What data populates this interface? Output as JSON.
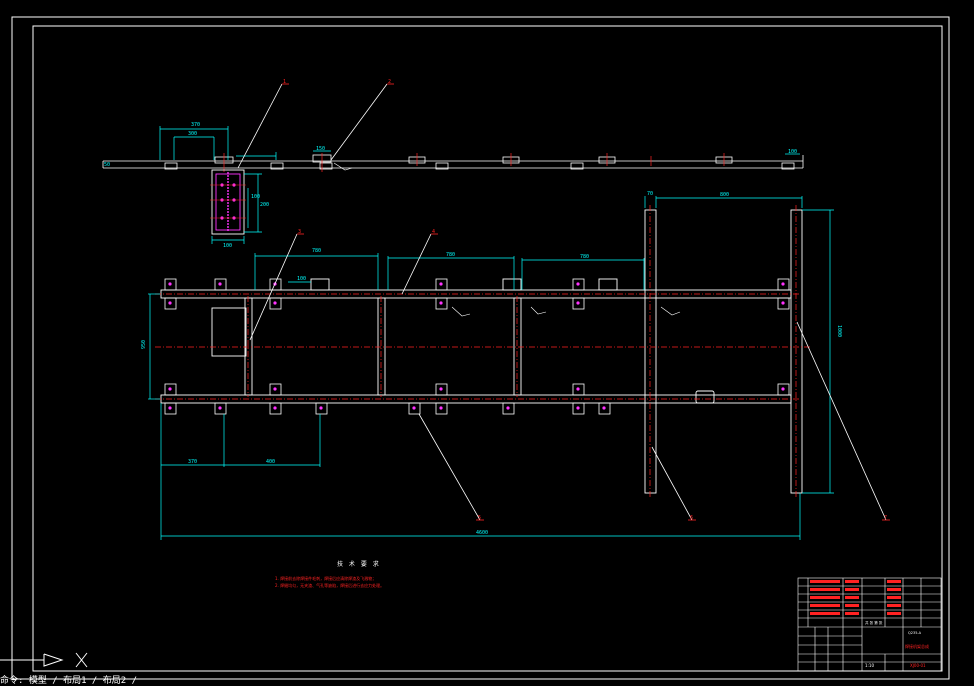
{
  "drawing": {
    "notes_title": "技 术 要 求",
    "notes": [
      "1. 焊接前去除焊接件毛刺，焊接后应清除焊渣及飞溅物；",
      "2. 焊缝均匀，无夹渣、气孔等缺陷，焊接后进行去应力处理。"
    ],
    "balloons": [
      "1",
      "2",
      "3",
      "4",
      "5",
      "6",
      "7",
      "8"
    ],
    "dims": {
      "top_width": "370",
      "top_inner": "300",
      "top_small": "150",
      "top_right": "100",
      "left_offset": "50",
      "col_h1": "100",
      "col_h2": "200",
      "col_w": "100",
      "span1": "780",
      "span2": "780",
      "span3": "780",
      "mid_small": "100",
      "frame_height": "950",
      "rail_width": "70",
      "rail_span": "800",
      "right_height": "1000",
      "bottom_left": "370",
      "bottom_mid": "400",
      "overall": "4600"
    },
    "title_block": {
      "drawing_name": "焊接机架总成",
      "drawing_no": "XJ00-01",
      "scale": "1:10",
      "sheet": "共 张 第 张",
      "material": "Q235-A"
    }
  },
  "colors": {
    "background": "#000000",
    "frame": "#ffffff",
    "dimension": "#00ffff",
    "centerline": "#ff2020",
    "balloon": "#ff2020",
    "bolt": "#ff33ff",
    "part": "#ffffff"
  },
  "command_line": "命令: 模型 / 布局1 / 布局2 /"
}
